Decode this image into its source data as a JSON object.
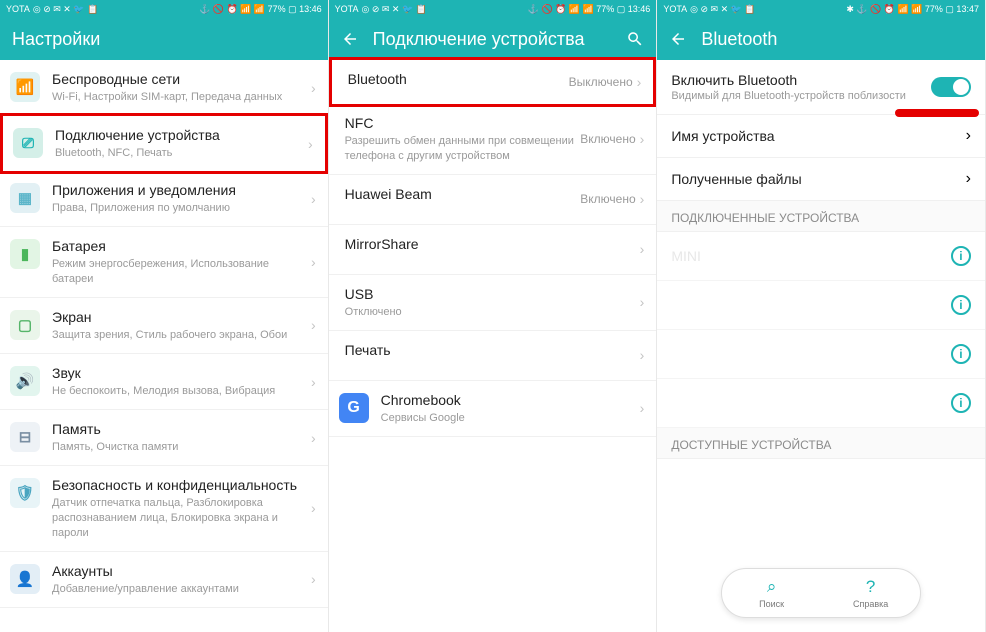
{
  "panel1": {
    "status": {
      "carrier": "YOTA",
      "icons": "◎ ⊘ ✉ ✕ 🐦 📋",
      "right": "⚓ 🚫 ⏰ 📶 📶 77% ▢ 13:46",
      "time": "13:46",
      "battery": "77%"
    },
    "title": "Настройки",
    "items": [
      {
        "icon_class": "icon-wireless",
        "sym": "📶",
        "color": "#1eb4b4",
        "title": "Беспроводные сети",
        "sub": "Wi-Fi, Настройки SIM-карт, Передача данных",
        "highlight": false
      },
      {
        "icon_class": "icon-device",
        "sym": "⎚",
        "color": "#1eb4b4",
        "title": "Подключение устройства",
        "sub": "Bluetooth, NFC, Печать",
        "highlight": true
      },
      {
        "icon_class": "icon-apps",
        "sym": "▦",
        "color": "#5bb5c9",
        "title": "Приложения и уведомления",
        "sub": "Права, Приложения по умолчанию",
        "highlight": false
      },
      {
        "icon_class": "icon-battery",
        "sym": "▮",
        "color": "#4bb65b",
        "title": "Батарея",
        "sub": "Режим энергосбережения, Использование батареи",
        "highlight": false
      },
      {
        "icon_class": "icon-display",
        "sym": "▢",
        "color": "#56b56a",
        "title": "Экран",
        "sub": "Защита зрения, Стиль рабочего экрана, Обои",
        "highlight": false
      },
      {
        "icon_class": "icon-sound",
        "sym": "🔊",
        "color": "#1eb4b4",
        "title": "Звук",
        "sub": "Не беспокоить, Мелодия вызова, Вибрация",
        "highlight": false
      },
      {
        "icon_class": "icon-storage",
        "sym": "⊟",
        "color": "#7a8fa3",
        "title": "Память",
        "sub": "Память, Очистка памяти",
        "highlight": false
      },
      {
        "icon_class": "icon-sec",
        "sym": "🛡",
        "color": "#4aa5c0",
        "title": "Безопасность и конфиденциальность",
        "sub": "Датчик отпечатка пальца, Разблокировка распознаванием лица, Блокировка экрана и пароли",
        "highlight": false
      },
      {
        "icon_class": "icon-acc",
        "sym": "👤",
        "color": "#4a88b8",
        "title": "Аккаунты",
        "sub": "Добавление/управление аккаунтами",
        "highlight": false
      }
    ]
  },
  "panel2": {
    "status": {
      "carrier": "YOTA",
      "icons": "◎ ⊘ ✉ ✕ 🐦 📋",
      "right": "⚓ 🚫 ⏰ 📶 📶 77% ▢ 13:46",
      "time": "13:46",
      "battery": "77%"
    },
    "title": "Подключение устройства",
    "items": [
      {
        "title": "Bluetooth",
        "sub": "",
        "val": "Выключено",
        "highlight": true
      },
      {
        "title": "NFC",
        "sub": "Разрешить обмен данными при совмещении телефона с другим устройством",
        "val": "Включено"
      },
      {
        "title": "Huawei Beam",
        "sub": "",
        "val": "Включено"
      },
      {
        "title": "MirrorShare",
        "sub": "",
        "val": ""
      },
      {
        "title": "USB",
        "sub": "Отключено",
        "val": "",
        "disabled": true
      },
      {
        "title": "Печать",
        "sub": "",
        "val": ""
      },
      {
        "title": "Chromebook",
        "sub": "Сервисы Google",
        "val": "",
        "icon": "G"
      }
    ]
  },
  "panel3": {
    "status": {
      "carrier": "YOTA",
      "icons": "◎ ⊘ ✉ ✕ 🐦 📋",
      "right": "✱ ⚓ 🚫 ⏰ 📶 📶 77% ▢ 13:47",
      "time": "13:47",
      "battery": "77%"
    },
    "title": "Bluetooth",
    "toggle": {
      "title": "Включить Bluetooth",
      "sub": "Видимый для Bluetooth-устройств поблизости",
      "on": true
    },
    "links": [
      {
        "title": "Имя устройства"
      },
      {
        "title": "Полученные файлы"
      }
    ],
    "section1": "ПОДКЛЮЧЕННЫЕ УСТРОЙСТВА",
    "devices1": [
      {
        "name": "        MINI"
      },
      {
        "name": " "
      },
      {
        "name": " "
      },
      {
        "name": " "
      }
    ],
    "section2": "ДОСТУПНЫЕ УСТРОЙСТВА",
    "fab": {
      "search": "Поиск",
      "help": "Справка"
    }
  }
}
